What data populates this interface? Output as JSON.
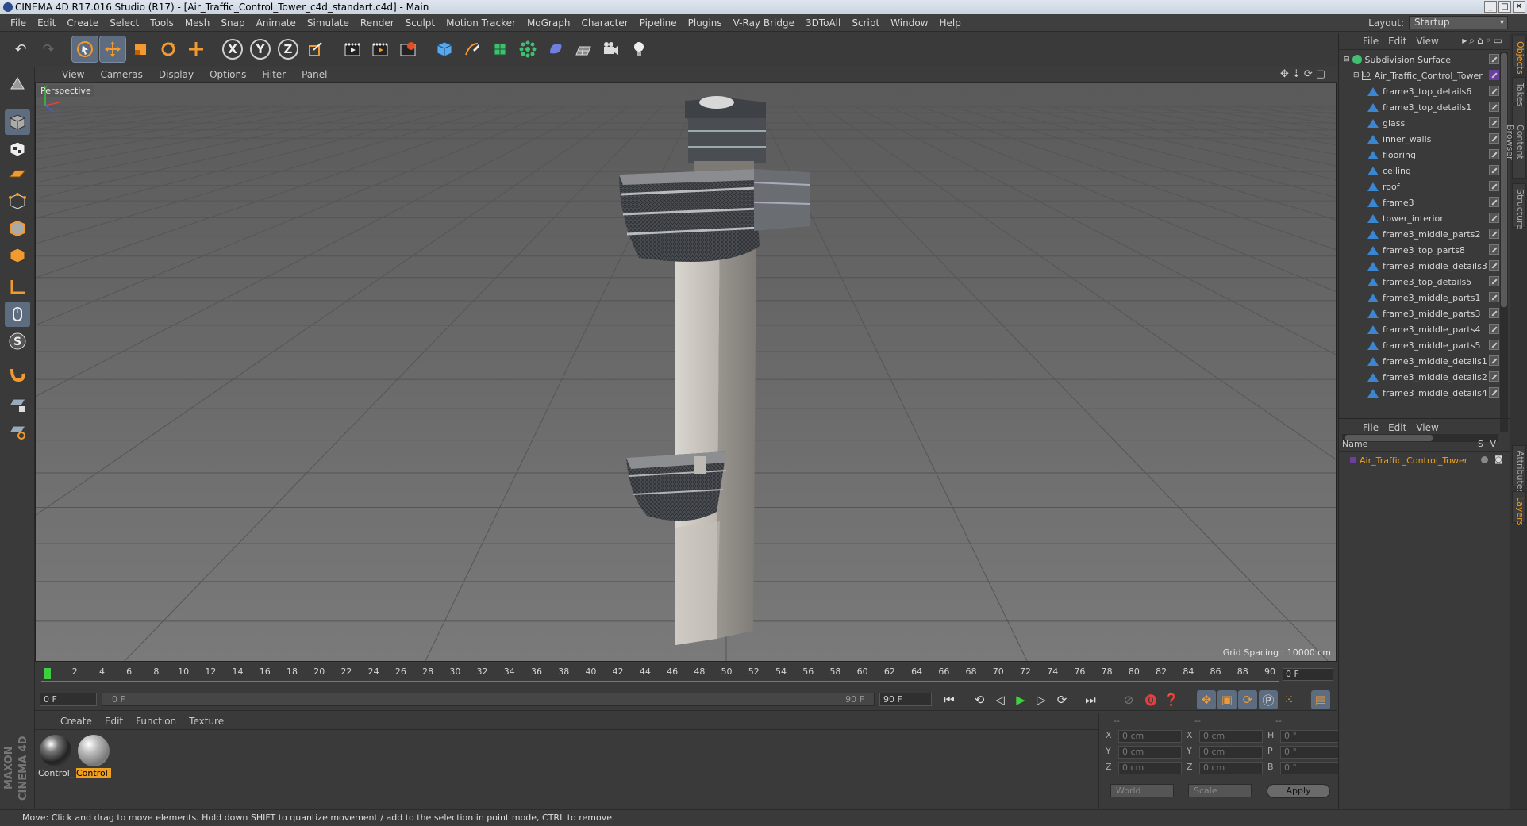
{
  "window": {
    "title": "CINEMA 4D R17.016 Studio (R17) - [Air_Traffic_Control_Tower_c4d_standart.c4d] - Main"
  },
  "menu": [
    "File",
    "Edit",
    "Create",
    "Select",
    "Tools",
    "Mesh",
    "Snap",
    "Animate",
    "Simulate",
    "Render",
    "Sculpt",
    "Motion Tracker",
    "MoGraph",
    "Character",
    "Pipeline",
    "Plugins",
    "V-Ray Bridge",
    "3DToAll",
    "Script",
    "Window",
    "Help"
  ],
  "layout": {
    "label": "Layout:",
    "value": "Startup"
  },
  "toolbar": {
    "x_label": "X",
    "y_label": "Y",
    "z_label": "Z"
  },
  "viewport": {
    "menu": [
      "View",
      "Cameras",
      "Display",
      "Options",
      "Filter",
      "Panel"
    ],
    "camera": "Perspective",
    "grid_spacing": "Grid Spacing : 10000 cm"
  },
  "timeline": {
    "ticks": [
      "0",
      "2",
      "4",
      "6",
      "8",
      "10",
      "12",
      "14",
      "16",
      "18",
      "20",
      "22",
      "24",
      "26",
      "28",
      "30",
      "32",
      "34",
      "36",
      "38",
      "40",
      "42",
      "44",
      "46",
      "48",
      "50",
      "52",
      "54",
      "56",
      "58",
      "60",
      "62",
      "64",
      "66",
      "68",
      "70",
      "72",
      "74",
      "76",
      "78",
      "80",
      "82",
      "84",
      "86",
      "88",
      "90"
    ],
    "current_frame": "0 F"
  },
  "transport": {
    "start_field": "0 F",
    "slider_left": "0 F",
    "slider_right": "90 F",
    "end_field": "90 F"
  },
  "material_panel": {
    "menu": [
      "Create",
      "Edit",
      "Function",
      "Texture"
    ],
    "materials": [
      {
        "label": "Control_",
        "selected": false
      },
      {
        "label": "Control_",
        "selected": true
      }
    ]
  },
  "coordinates": {
    "header": [
      "--",
      "--",
      "--"
    ],
    "rows": [
      {
        "a": "X",
        "av": "0 cm",
        "b": "X",
        "bv": "0 cm",
        "c": "H",
        "cv": "0 °"
      },
      {
        "a": "Y",
        "av": "0 cm",
        "b": "Y",
        "bv": "0 cm",
        "c": "P",
        "cv": "0 °"
      },
      {
        "a": "Z",
        "av": "0 cm",
        "b": "Z",
        "bv": "0 cm",
        "c": "B",
        "cv": "0 °"
      }
    ],
    "mode": "World",
    "scale": "Scale",
    "apply": "Apply"
  },
  "status": "Move: Click and drag to move elements. Hold down SHIFT to quantize movement / add to the selection in point mode, CTRL to remove.",
  "logo": "MAXON CINEMA 4D",
  "object_manager": {
    "menu": [
      "File",
      "Edit",
      "View"
    ],
    "root": "Subdivision Surface",
    "group": "Air_Traffic_Control_Tower",
    "objects": [
      "frame3_top_details6",
      "frame3_top_details1",
      "glass",
      "inner_walls",
      "flooring",
      "ceiling",
      "roof",
      "frame3",
      "tower_interior",
      "frame3_middle_parts2",
      "frame3_top_parts8",
      "frame3_middle_details3",
      "frame3_top_details5",
      "frame3_middle_parts1",
      "frame3_middle_parts3",
      "frame3_middle_parts4",
      "frame3_middle_parts5",
      "frame3_middle_details1",
      "frame3_middle_details2",
      "frame3_middle_details4"
    ]
  },
  "layer_manager": {
    "menu": [
      "File",
      "Edit",
      "View"
    ],
    "col_name": "Name",
    "col_s": "S",
    "col_v": "V",
    "layer": "Air_Traffic_Control_Tower"
  },
  "side_tabs": [
    "Objects",
    "Takes",
    "Content Browser",
    "Structure",
    "Attributes",
    "Layers"
  ],
  "colors": {
    "accent": "#f0a020",
    "layer_text": "#f0a020",
    "object_icon": "#3a86d0",
    "playhead": "#3fd03f"
  }
}
